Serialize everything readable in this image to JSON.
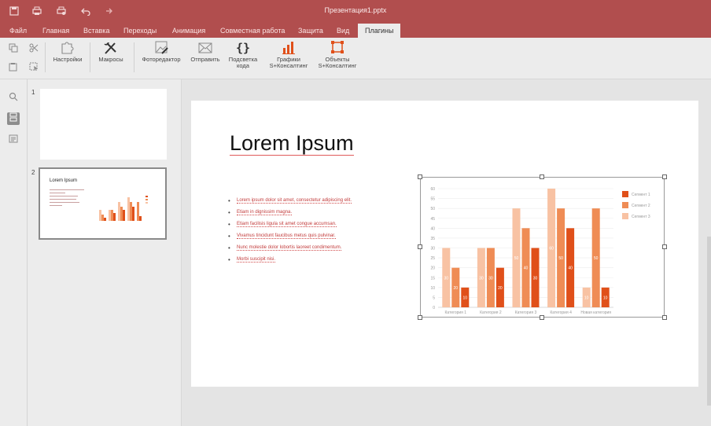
{
  "window": {
    "title": "Презентация1.pptx"
  },
  "quick_access": [
    "save-icon",
    "print-icon",
    "quick-print-icon",
    "undo-icon",
    "redo-icon"
  ],
  "menu": {
    "items": [
      "Файл",
      "Главная",
      "Вставка",
      "Переходы",
      "Анимация",
      "Совместная работа",
      "Защита",
      "Вид",
      "Плагины"
    ],
    "active_index": 8
  },
  "toolbar": {
    "buttons": [
      {
        "label": "Настройки",
        "icon": "puzzle-icon"
      },
      {
        "label": "Макросы",
        "icon": "tools-icon"
      },
      {
        "label": "Фоторедактор",
        "icon": "photo-editor-icon"
      },
      {
        "label": "Отправить",
        "icon": "envelope-icon"
      },
      {
        "label": "Подсветка\nкода",
        "icon": "braces-icon"
      },
      {
        "label": "Графики\nS+Консалтинг",
        "icon": "bar-chart-icon"
      },
      {
        "label": "Объекты\nS+Консалтинг",
        "icon": "objects-icon"
      }
    ],
    "small_icons": [
      "copy-icon",
      "cut-icon",
      "paste-icon",
      "select-icon"
    ]
  },
  "left_rail": [
    "search-icon",
    "slides-icon",
    "comments-icon"
  ],
  "thumbnails": [
    {
      "number": "1",
      "title": ""
    },
    {
      "number": "2",
      "title": "Lorem Ipsum"
    }
  ],
  "slide": {
    "title": "Lorem Ipsum",
    "bullets": [
      "Lorem ipsum dolor sit amet, consectetur adipiscing elit.",
      "Etiam in dignissim magna.",
      "Etiam facilisis ligula sit amet congue accumsan.",
      "Vivamus tincidunt faucibus metus quis pulvinar.",
      "Nunc molestie dolor lobortis laoreet condimentum.",
      "Morbi suscipit nisi."
    ]
  },
  "chart_data": {
    "type": "bar",
    "categories": [
      "Категория 1",
      "Категория 2",
      "Категория 3",
      "Категория 4",
      "Новая категория"
    ],
    "series": [
      {
        "name": "Сегмент 1",
        "values": [
          10,
          20,
          30,
          40,
          10
        ],
        "color": "#e0501a"
      },
      {
        "name": "Сегмент 2",
        "values": [
          20,
          30,
          40,
          50,
          50
        ],
        "color": "#ef8c55"
      },
      {
        "name": "Сегмент 3",
        "values": [
          30,
          30,
          50,
          60,
          10
        ],
        "color": "#f8c2a3"
      }
    ],
    "ylim": [
      0,
      60
    ],
    "yticks": [
      0,
      5,
      10,
      15,
      20,
      25,
      30,
      35,
      40,
      45,
      50,
      55,
      60
    ],
    "grid": true,
    "legend": "right"
  }
}
